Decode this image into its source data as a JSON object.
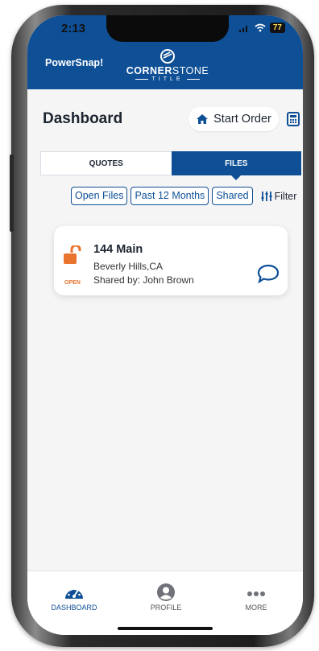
{
  "status": {
    "time": "2:13",
    "battery": "77"
  },
  "header": {
    "app_name": "PowerSnap!",
    "logo_text_light": "STONE",
    "logo_text_bold": "CORNER",
    "logo_sub": "TITLE"
  },
  "page": {
    "title": "Dashboard",
    "start_order_label": "Start Order"
  },
  "tabs": [
    {
      "label": "QUOTES",
      "active": false
    },
    {
      "label": "FILES",
      "active": true
    }
  ],
  "filters": {
    "chips": [
      "Open Files",
      "Past 12 Months",
      "Shared"
    ],
    "filter_label": "Filter"
  },
  "files": [
    {
      "title": "144 Main",
      "location": "Beverly Hills,CA",
      "shared_by": "Shared by: John Brown",
      "status": "OPEN"
    }
  ],
  "bottom_nav": [
    {
      "label": "DASHBOARD",
      "icon": "speedometer-icon",
      "active": true
    },
    {
      "label": "PROFILE",
      "icon": "person-icon",
      "active": false
    },
    {
      "label": "MORE",
      "icon": "more-dots-icon",
      "active": false
    }
  ],
  "colors": {
    "primary": "#0e4f96",
    "open_orange": "#e8742e"
  }
}
